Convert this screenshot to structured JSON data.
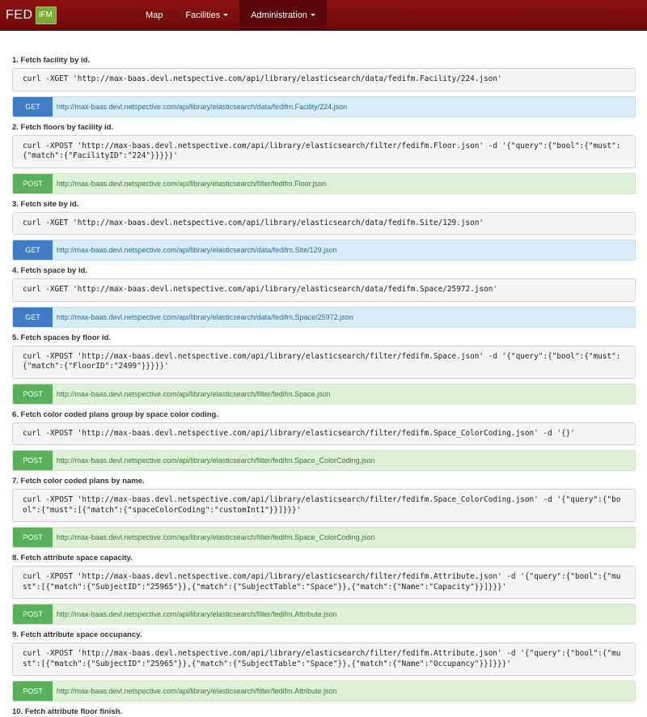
{
  "navbar": {
    "brand_text": "FED",
    "brand_badge": "iFM",
    "items": [
      {
        "label": "Map"
      },
      {
        "label": "Facilities"
      },
      {
        "label": "Administration"
      }
    ]
  },
  "entries": [
    {
      "title": "1. Fetch facility by id.",
      "command": "curl -XGET 'http://max-baas.devl.netspective.com/api/library/elasticsearch/data/fedifm.Facility/224.json'",
      "method": "GET",
      "url": "http://max-baas.devl.netspective.com/api/library/elasticsearch/data/fedifm.Facility/224.json"
    },
    {
      "title": "2. Fetch floors by facility id.",
      "command": "curl -XPOST 'http://max-baas.devl.netspective.com/api/library/elasticsearch/filter/fedifm.Floor.json' -d '{\"query\":{\"bool\":{\"must\":{\"match\":{\"FacilityID\":\"224\"}}}}}'",
      "method": "POST",
      "url": "http://max-baas.devl.netspective.com/api/library/elasticsearch/filter/fedifm.Floor.json"
    },
    {
      "title": "3. Fetch site by id.",
      "command": "curl -XGET 'http://max-baas.devl.netspective.com/api/library/elasticsearch/data/fedifm.Site/129.json'",
      "method": "GET",
      "url": "http://max-baas.devl.netspective.com/api/library/elasticsearch/data/fedifm.Site/129.json"
    },
    {
      "title": "4. Fetch space by id.",
      "command": "curl -XGET 'http://max-baas.devl.netspective.com/api/library/elasticsearch/data/fedifm.Space/25972.json'",
      "method": "GET",
      "url": "http://max-baas.devl.netspective.com/api/library/elasticsearch/data/fedifm.Space/25972.json"
    },
    {
      "title": "5. Fetch spaces by floor id.",
      "command": "curl -XPOST 'http://max-baas.devl.netspective.com/api/library/elasticsearch/filter/fedifm.Space.json' -d '{\"query\":{\"bool\":{\"must\":{\"match\":{\"FloorID\":\"2499\"}}}}}'",
      "method": "POST",
      "url": "http://max-baas.devl.netspective.com/api/library/elasticsearch/filter/fedifm.Space.json"
    },
    {
      "title": "6. Fetch color coded plans group by space color coding.",
      "command": "curl -XPOST 'http://max-baas.devl.netspective.com/api/library/elasticsearch/filter/fedifm.Space_ColorCoding.json' -d '{}'",
      "method": "POST",
      "url": "http://max-baas.devl.netspective.com/api/library/elasticsearch/filter/fedifm.Space_ColorCoding.json"
    },
    {
      "title": "7. Fetch color coded plans by name.",
      "command": "curl -XPOST 'http://max-baas.devl.netspective.com/api/library/elasticsearch/filter/fedifm.Space_ColorCoding.json' -d '{\"query\":{\"bool\":{\"must\":[{\"match\":{\"spaceColorCoding\":\"customInt1\"}}]}}}'",
      "method": "POST",
      "url": "http://max-baas.devl.netspective.com/api/library/elasticsearch/filter/fedifm.Space_ColorCoding.json"
    },
    {
      "title": "8. Fetch attribute space capacity.",
      "command": "curl -XPOST 'http://max-baas.devl.netspective.com/api/library/elasticsearch/filter/fedifm.Attribute.json' -d '{\"query\":{\"bool\":{\"must\":[{\"match\":{\"SubjectID\":\"25965\"}},{\"match\":{\"SubjectTable\":\"Space\"}},{\"match\":{\"Name\":\"Capacity\"}}]}}}'",
      "method": "POST",
      "url": "http://max-baas.devl.netspective.com/api/library/elasticsearch/filter/fedifm.Attribute.json"
    },
    {
      "title": "9. Fetch attribute space occupancy.",
      "command": "curl -XPOST 'http://max-baas.devl.netspective.com/api/library/elasticsearch/filter/fedifm.Attribute.json' -d '{\"query\":{\"bool\":{\"must\":[{\"match\":{\"SubjectID\":\"25965\"}},{\"match\":{\"SubjectTable\":\"Space\"}},{\"match\":{\"Name\":\"Occupancy\"}}]}}}'",
      "method": "POST",
      "url": "http://max-baas.devl.netspective.com/api/library/elasticsearch/filter/fedifm.Attribute.json"
    },
    {
      "title": "10. Fetch attribute floor finish.",
      "command": "",
      "method": "",
      "url": ""
    }
  ],
  "colors": {
    "navbar": "#7a0d0d",
    "get_badge": "#3f7cc8",
    "post_badge": "#5bb05d",
    "get_row": "#d9edf7",
    "post_row": "#dff0d8"
  }
}
